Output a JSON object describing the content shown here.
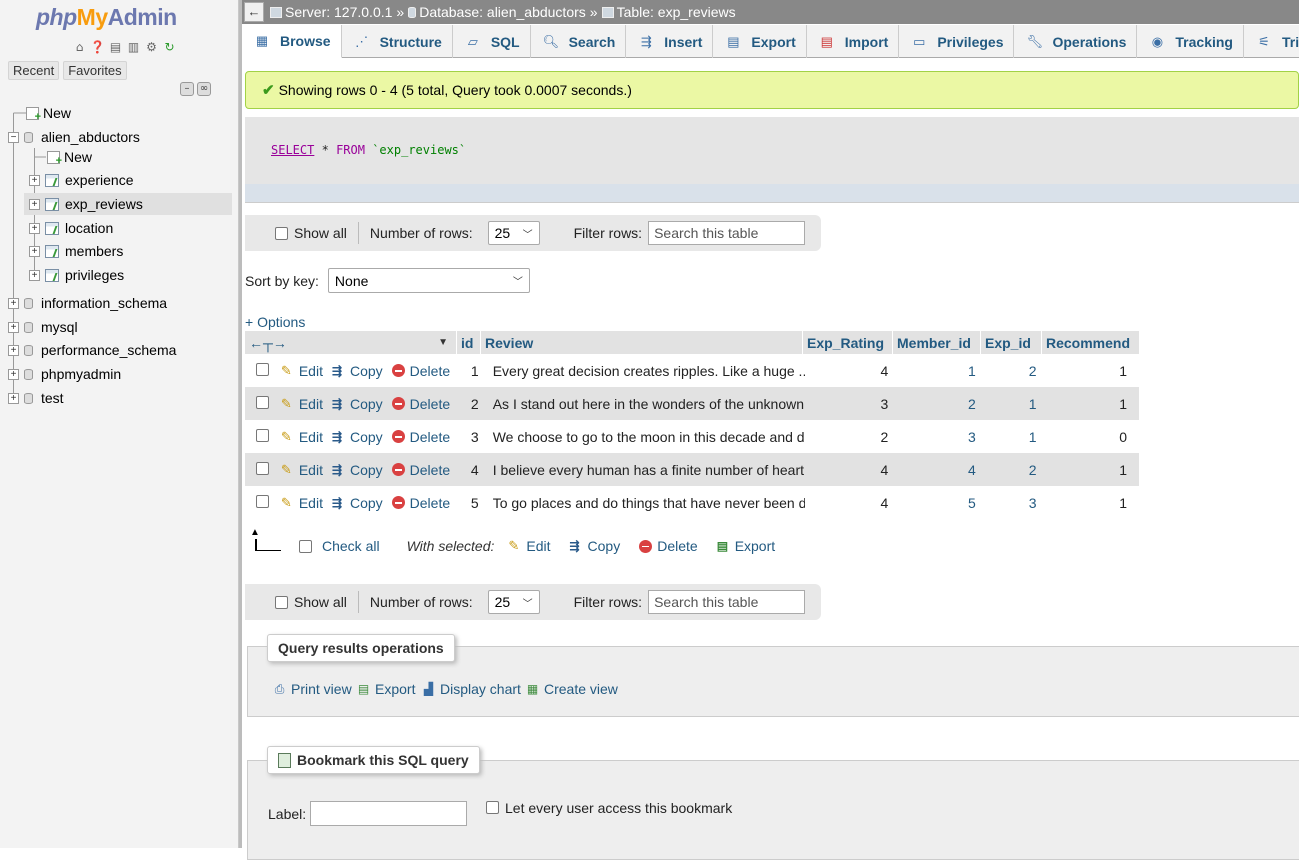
{
  "nav": {
    "logo": {
      "php": "php",
      "my": "My",
      "admin": "Admin"
    },
    "icons": [
      "home-icon",
      "help-icon",
      "docs-icon",
      "sql-docs-icon",
      "settings-icon",
      "reload-icon"
    ],
    "tabs": [
      "Recent",
      "Favorites"
    ],
    "tree": [
      {
        "label": "New",
        "kind": "new",
        "level": 0
      },
      {
        "label": "alien_abductors",
        "kind": "db",
        "level": 0,
        "expanded": true
      },
      {
        "label": "New",
        "kind": "new",
        "level": 1
      },
      {
        "label": "experience",
        "kind": "table",
        "level": 1
      },
      {
        "label": "exp_reviews",
        "kind": "table",
        "level": 1,
        "active": true
      },
      {
        "label": "location",
        "kind": "table",
        "level": 1
      },
      {
        "label": "members",
        "kind": "table",
        "level": 1
      },
      {
        "label": "privileges",
        "kind": "table",
        "level": 1
      },
      {
        "label": "information_schema",
        "kind": "db",
        "level": 0
      },
      {
        "label": "mysql",
        "kind": "db",
        "level": 0
      },
      {
        "label": "performance_schema",
        "kind": "db",
        "level": 0
      },
      {
        "label": "phpmyadmin",
        "kind": "db",
        "level": 0
      },
      {
        "label": "test",
        "kind": "db",
        "level": 0
      }
    ]
  },
  "breadcrumb": {
    "server": "Server: 127.0.0.1",
    "sep": "»",
    "database": "Database: alien_abductors",
    "table": "Table: exp_reviews"
  },
  "tabs": [
    {
      "label": "Browse",
      "icon": "browse-icon",
      "active": true
    },
    {
      "label": "Structure",
      "icon": "structure-icon"
    },
    {
      "label": "SQL",
      "icon": "sql-icon"
    },
    {
      "label": "Search",
      "icon": "search-icon"
    },
    {
      "label": "Insert",
      "icon": "insert-icon"
    },
    {
      "label": "Export",
      "icon": "export-icon"
    },
    {
      "label": "Import",
      "icon": "import-icon"
    },
    {
      "label": "Privileges",
      "icon": "privileges-icon"
    },
    {
      "label": "Operations",
      "icon": "operations-icon"
    },
    {
      "label": "Tracking",
      "icon": "tracking-icon"
    },
    {
      "label": "Triggers",
      "icon": "triggers-icon"
    }
  ],
  "success_message": "Showing rows 0 - 4 (5 total, Query took 0.0007 seconds.)",
  "sql": {
    "select": "SELECT",
    "star": "*",
    "from": "FROM",
    "table": "`exp_reviews`"
  },
  "navbar": {
    "show_all": "Show all",
    "number_of_rows_label": "Number of rows:",
    "number_of_rows_value": "25",
    "filter_label": "Filter rows:",
    "filter_placeholder": "Search this table"
  },
  "sort": {
    "label": "Sort by key:",
    "value": "None"
  },
  "options_link": "+ Options",
  "table": {
    "columns": [
      "id",
      "Review",
      "Exp_Rating",
      "Member_id",
      "Exp_id",
      "Recommend"
    ],
    "actions": {
      "edit": "Edit",
      "copy": "Copy",
      "delete": "Delete"
    },
    "rows": [
      {
        "id": "1",
        "review": "Every great decision creates ripples. Like a huge ...",
        "exp_rating": "4",
        "member_id": "1",
        "exp_id": "2",
        "recommend": "1"
      },
      {
        "id": "2",
        "review": "As I stand out here in the wonders of the unknown ...",
        "exp_rating": "3",
        "member_id": "2",
        "exp_id": "1",
        "recommend": "1"
      },
      {
        "id": "3",
        "review": "We choose to go to the moon in this decade and do ...",
        "exp_rating": "2",
        "member_id": "3",
        "exp_id": "1",
        "recommend": "0"
      },
      {
        "id": "4",
        "review": "I believe every human has a finite number of heart...",
        "exp_rating": "4",
        "member_id": "4",
        "exp_id": "2",
        "recommend": "1"
      },
      {
        "id": "5",
        "review": "To go places and do things that have never been do...",
        "exp_rating": "4",
        "member_id": "5",
        "exp_id": "3",
        "recommend": "1"
      }
    ]
  },
  "bulk": {
    "check_all": "Check all",
    "with_selected": "With selected:",
    "edit": "Edit",
    "copy": "Copy",
    "delete": "Delete",
    "export": "Export"
  },
  "query_ops": {
    "legend": "Query results operations",
    "print_view": "Print view",
    "export": "Export",
    "display_chart": "Display chart",
    "create_view": "Create view"
  },
  "bookmark": {
    "legend": "Bookmark this SQL query",
    "label": "Label:",
    "label_value": "",
    "shared": "Let every user access this bookmark"
  }
}
